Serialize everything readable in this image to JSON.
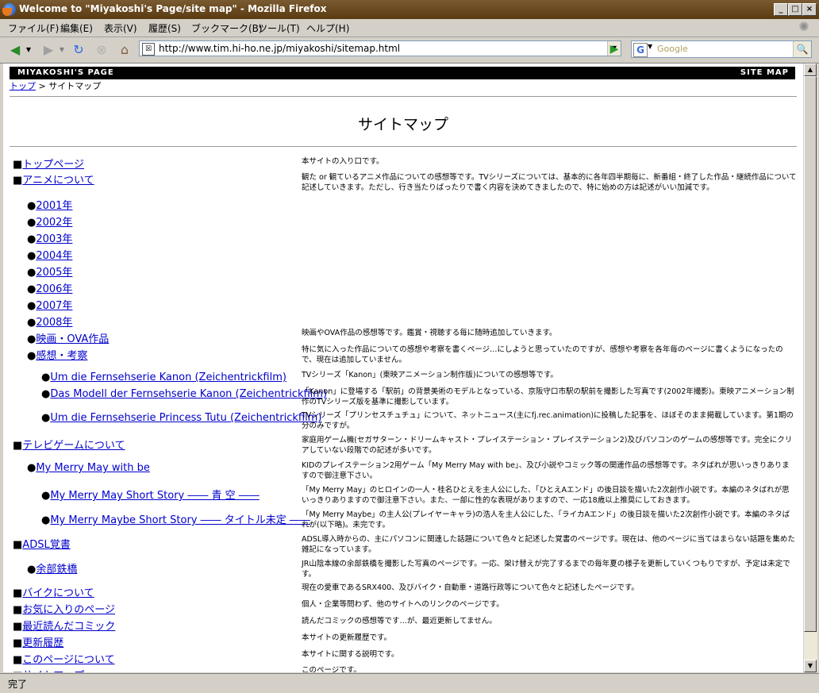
{
  "window": {
    "title": "Welcome to \"Miyakoshi's Page/site map\" - Mozilla Firefox"
  },
  "menu": [
    "ファイル(F)",
    "編集(E)",
    "表示(V)",
    "履歴(S)",
    "ブックマーク(B)",
    "ツール(T)",
    "ヘルプ(H)"
  ],
  "url": "http://www.tim.hi-ho.ne.jp/miyakoshi/sitemap.html",
  "search_placeholder": "Google",
  "status": "完了",
  "site": {
    "name": "MIYAKOSHI'S PAGE",
    "section": "SITE MAP"
  },
  "breadcrumb": {
    "home": "トップ",
    "sep": " > ",
    "current": "サイトマップ"
  },
  "page_title": "サイトマップ",
  "items": [
    {
      "bullet": "■",
      "label": "トップページ",
      "desc": "本サイトの入り口です。"
    },
    {
      "bullet": "■",
      "label": "アニメについて",
      "desc": "観た or 観ているアニメ作品についての感想等です。TVシリーズについては、基本的に各年四半期毎に、新番組・終了した作品・継続作品について記述していきます。ただし、行き当たりばったりで書く内容を決めてきましたので、特に始めの方は記述がいい加減です。"
    },
    {
      "bullet": "●",
      "label": "2001年",
      "desc": ""
    },
    {
      "bullet": "●",
      "label": "2002年",
      "desc": ""
    },
    {
      "bullet": "●",
      "label": "2003年",
      "desc": ""
    },
    {
      "bullet": "●",
      "label": "2004年",
      "desc": ""
    },
    {
      "bullet": "●",
      "label": "2005年",
      "desc": ""
    },
    {
      "bullet": "●",
      "label": "2006年",
      "desc": ""
    },
    {
      "bullet": "●",
      "label": "2007年",
      "desc": ""
    },
    {
      "bullet": "●",
      "label": "2008年",
      "desc": ""
    },
    {
      "bullet": "●",
      "label": "映画・OVA作品",
      "desc": "映画やOVA作品の感想等です。鑑賞・視聴する毎に随時追加していきます。"
    },
    {
      "bullet": "●",
      "label": "感想・考察",
      "desc": "特に気に入った作品についての感想や考察を書くページ…にしようと思っていたのですが、感想や考察を各年毎のページに書くようになったので、現在は追加していません。"
    },
    {
      "bullet": "●",
      "label": "Um die Fernsehserie Kanon (Zeichentrickfilm)",
      "desc": "TVシリーズ「Kanon」(東映アニメーション制作版)についての感想等です。"
    },
    {
      "bullet": "●",
      "label": "Das Modell der Fernsehserie Kanon (Zeichentrickfilm)",
      "desc": "「Kanon」に登場する「駅前」の背景美術のモデルとなっている、京阪守口市駅の駅前を撮影した写真です(2002年撮影)。東映アニメーション制作のTVシリーズ版を基準に撮影しています。"
    },
    {
      "bullet": "●",
      "label": "Um die Fernsehserie Princess Tutu (Zeichentrickfilm)",
      "desc": "TVシリーズ「プリンセスチュチュ」について、ネットニュース(主にfj.rec.animation)に投稿した記事を、ほぼそのまま掲載しています。第1期の分のみですが。"
    },
    {
      "bullet": "■",
      "label": "テレビゲームについて",
      "desc": "家庭用ゲーム機(セガサターン・ドリームキャスト・プレイステーション・プレイステーション2)及びパソコンのゲームの感想等です。完全にクリアしていない段階での記述が多いです。"
    },
    {
      "bullet": "●",
      "label": "My Merry May with be",
      "desc": "KIDのプレイステーション2用ゲーム「My Merry May with be」、及び小説やコミック等の関連作品の感想等です。ネタばれが思いっきりありますので御注意下さい。"
    },
    {
      "bullet": "●",
      "label": "My Merry May Short Story ―― 青 空 ――",
      "desc": "「My Merry May」のヒロインの一人・桂名ひとえを主人公にした、「ひとえAエンド」の後日談を描いた2次創作小説です。本編のネタばれが思いっきりありますので御注意下さい。また、一部に性的な表現がありますので、一応18歳以上推奨にしておきます。"
    },
    {
      "bullet": "●",
      "label": "My Merry Maybe Short Story ―― タイトル未定 ――",
      "desc": "「My Merry Maybe」の主人公(プレイヤーキャラ)の浩人を主人公にした、「ライカAエンド」の後日談を描いた2次創作小説です。本編のネタばれが(以下略)。未完です。"
    },
    {
      "bullet": "■",
      "label": "ADSL覚書",
      "desc": "ADSL導入時からの、主にパソコンに関連した話題について色々と記述した覚書のページです。現在は、他のページに当てはまらない話題を集めた雑記になっています。"
    },
    {
      "bullet": "●",
      "label": "余部鉄橋",
      "desc": "JR山陰本線の余部鉄橋を撮影した写真のページです。一応、架け替えが完了するまでの毎年夏の様子を更新していくつもりですが、予定は未定です。"
    },
    {
      "bullet": "■",
      "label": "バイクについて",
      "desc": "現在の愛車であるSRX400、及びバイク・自動車・道路行政等について色々と記述したページです。"
    },
    {
      "bullet": "■",
      "label": "お気に入りのページ",
      "desc": "個人・企業等問わず、他のサイトへのリンクのページです。"
    },
    {
      "bullet": "■",
      "label": "最近読んだコミック",
      "desc": "読んだコミックの感想等です…が、最近更新してません。"
    },
    {
      "bullet": "■",
      "label": "更新履歴",
      "desc": "本サイトの更新履歴です。"
    },
    {
      "bullet": "■",
      "label": "このページについて",
      "desc": "本サイトに関する説明です。"
    },
    {
      "bullet": "■",
      "label": "サイトマップ",
      "desc": "このページです。"
    }
  ]
}
